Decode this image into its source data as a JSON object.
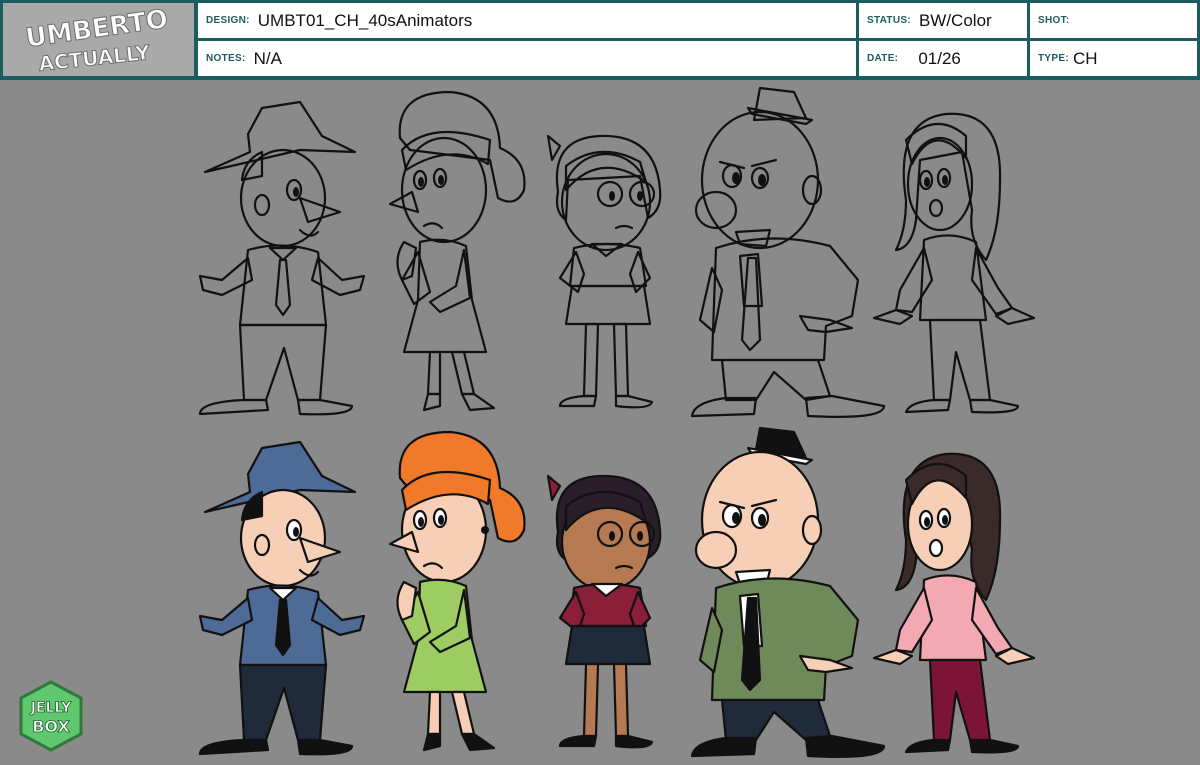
{
  "header": {
    "logo_text_line1": "UMBERTO",
    "logo_text_line2": "ACTUALLY",
    "design_label": "DESIGN:",
    "design_value": "UMBT01_CH_40sAnimators",
    "notes_label": "NOTES:",
    "notes_value": "N/A",
    "status_label": "STATUS:",
    "status_value": "BW/Color",
    "date_label": "DATE:",
    "date_value": "01/26",
    "shot_label": "SHOT:",
    "shot_value": "",
    "type_label": "TYPE:",
    "type_value": "CH"
  },
  "studio_logo": {
    "line1": "JELLY",
    "line2": "BOX"
  },
  "colors": {
    "header_border": "#1d5c5e",
    "background": "#8a8a8a",
    "logo_bg": "#a9a9a9",
    "skin_light": "#f6cfb6",
    "skin_dark": "#b57a52",
    "suit_blue": "#4e6a96",
    "hair_orange": "#f0792a",
    "dress_green": "#9ccc62",
    "top_maroon": "#8a1f3a",
    "coat_green": "#6f8a5a",
    "blouse_pink": "#f2a9b2",
    "pants_maroon": "#7c1438",
    "hair_dark": "#3a2a2a",
    "studio_logo_green": "#5fc86e"
  },
  "characters": [
    {
      "name": "hat-man"
    },
    {
      "name": "orange-hair-woman"
    },
    {
      "name": "girl-with-glasses"
    },
    {
      "name": "bald-man-in-coat"
    },
    {
      "name": "long-hair-woman"
    }
  ]
}
